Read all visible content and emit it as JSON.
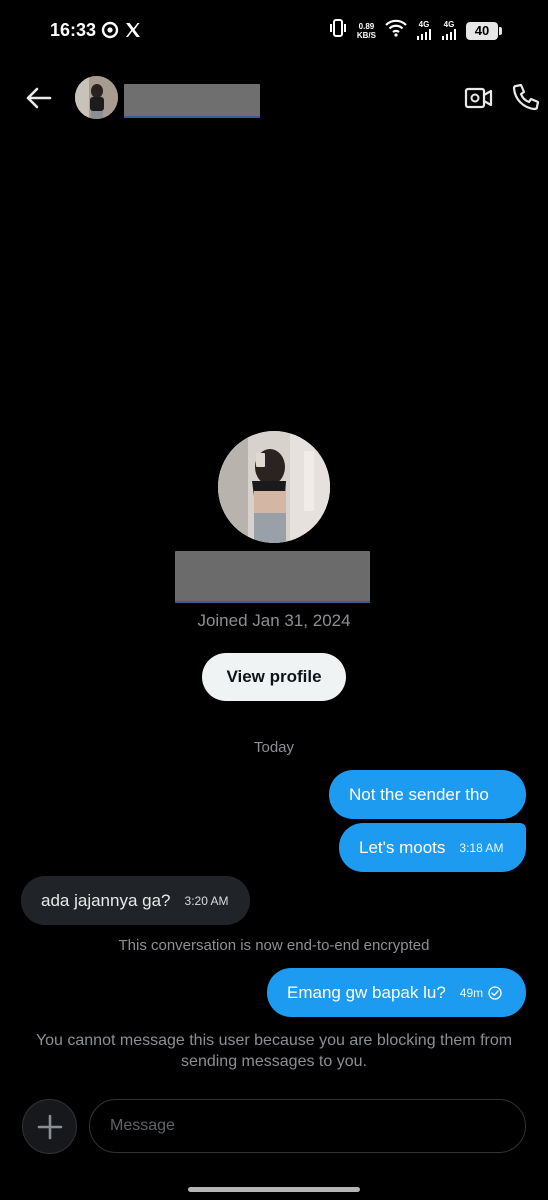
{
  "status": {
    "time": "16:33",
    "net_speed_value": "0.89",
    "net_speed_unit": "KB/S",
    "signal1": "4G",
    "signal2": "4G",
    "battery": "40"
  },
  "header": {
    "back_icon": "arrow-left-icon",
    "video_icon": "video-call-icon",
    "call_icon": "phone-icon"
  },
  "profile": {
    "joined": "Joined Jan 31, 2024",
    "view_profile_label": "View profile"
  },
  "conversation": {
    "day_label": "Today",
    "messages": [
      {
        "direction": "sent",
        "text": "Not the sender tho",
        "time": ""
      },
      {
        "direction": "sent",
        "text": "Let's moots",
        "time": "3:18 AM"
      },
      {
        "direction": "received",
        "text": "ada jajannya ga?",
        "time": "3:20 AM"
      },
      {
        "direction": "sent",
        "text": "Emang gw bapak lu?",
        "time": "49m"
      }
    ],
    "encrypted_notice": "This conversation is now end-to-end encrypted",
    "blocked_notice": "You cannot message this user because you are blocking them from sending messages to you."
  },
  "composer": {
    "placeholder": "Message",
    "value": ""
  },
  "colors": {
    "accent": "#1d9bf0",
    "background": "#000000",
    "received_bubble": "#202327",
    "muted_text": "#8b8f94"
  }
}
